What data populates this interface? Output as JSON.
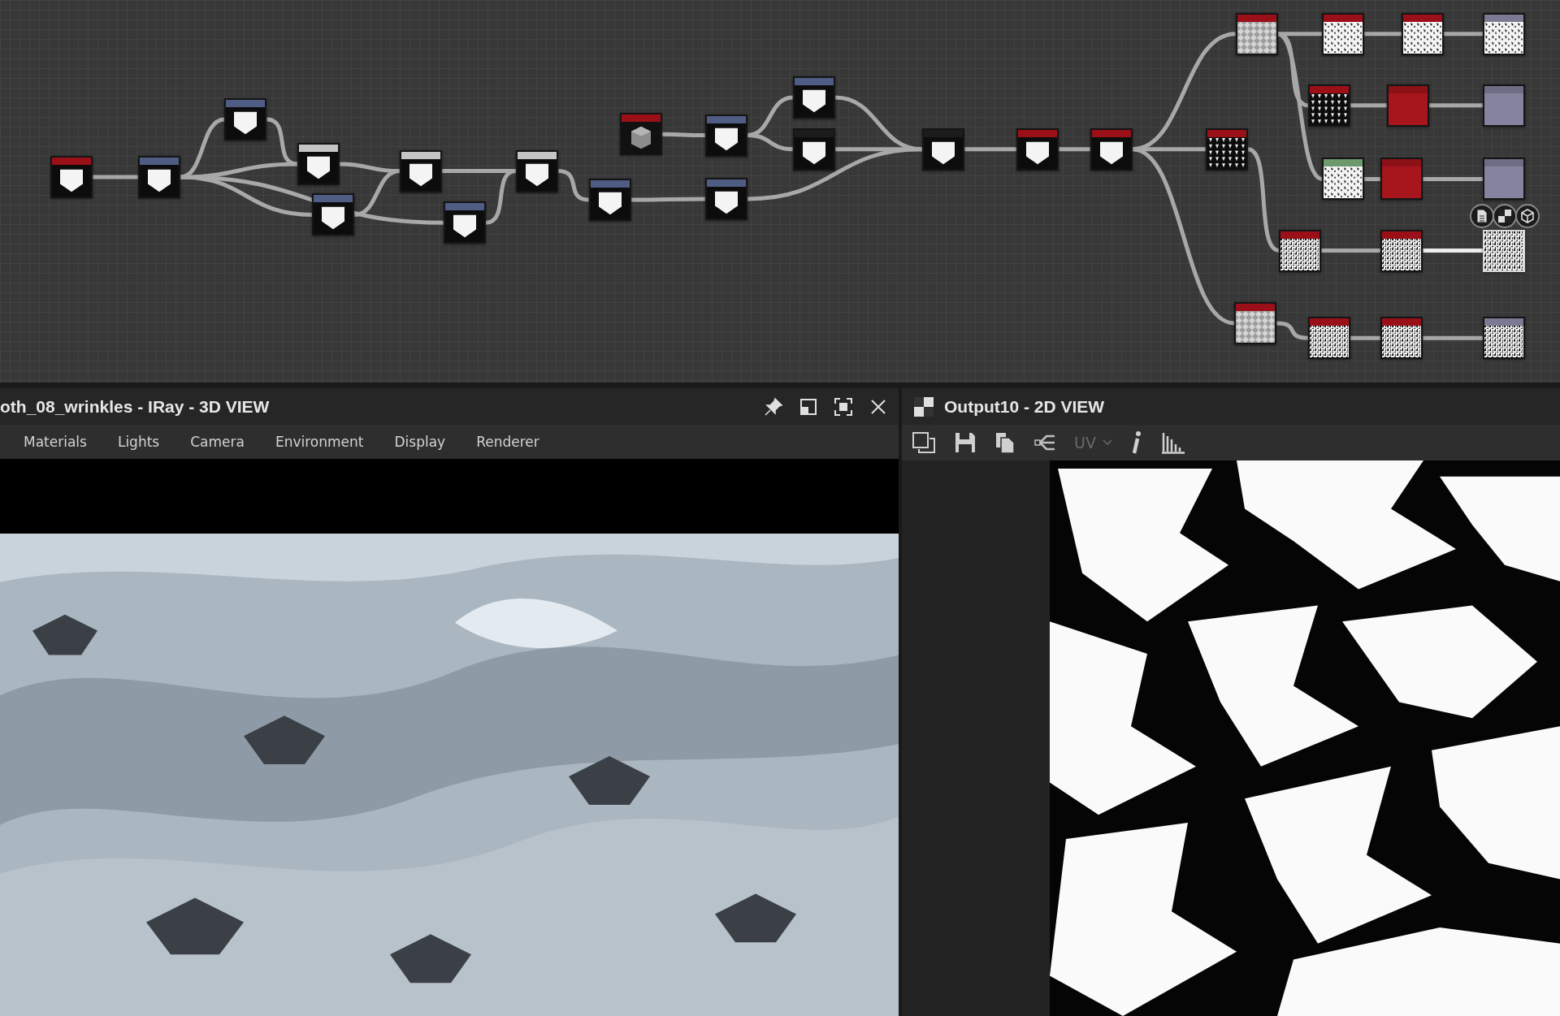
{
  "graph": {
    "nodes": [
      {
        "color": "#9b1018",
        "kind": "shape",
        "selected": false
      },
      {
        "color": "#4f5d85",
        "kind": "shape",
        "selected": false
      },
      {
        "color": "#4f5d85",
        "kind": "shape",
        "selected": false
      },
      {
        "color": "#c4c4c4",
        "kind": "shape",
        "selected": false
      },
      {
        "color": "#4f5d85",
        "kind": "shape",
        "selected": false
      },
      {
        "color": "#c4c4c4",
        "kind": "shape",
        "selected": false
      },
      {
        "color": "#4f5d85",
        "kind": "shape",
        "selected": false
      },
      {
        "color": "#c4c4c4",
        "kind": "shape",
        "selected": false
      },
      {
        "color": "#4f5d85",
        "kind": "shape",
        "selected": false
      },
      {
        "color": "#9b1018",
        "kind": "cube",
        "selected": false
      },
      {
        "color": "#4f5d85",
        "kind": "shape",
        "selected": false
      },
      {
        "color": "#4f5d85",
        "kind": "shape",
        "selected": false
      },
      {
        "color": "#1c1c1c",
        "kind": "shape",
        "selected": false
      },
      {
        "color": "#4f5d85",
        "kind": "shape",
        "selected": false
      },
      {
        "color": "#1c1c1c",
        "kind": "shape",
        "selected": false
      },
      {
        "color": "#9b1018",
        "kind": "shape",
        "selected": false
      },
      {
        "color": "#9b1018",
        "kind": "shape",
        "selected": false
      },
      {
        "color": "#9b1018",
        "kind": "grey-pattern",
        "selected": false
      },
      {
        "color": "#9b1018",
        "kind": "pattern",
        "selected": false
      },
      {
        "color": "#9b1018",
        "kind": "pattern",
        "selected": false
      },
      {
        "color": "#7c7a92",
        "kind": "pattern",
        "selected": false
      },
      {
        "color": "#9b1018",
        "kind": "dark-pattern",
        "selected": false
      },
      {
        "color": "#8c1218",
        "kind": "solid",
        "selected": false
      },
      {
        "color": "#6f6d85",
        "kind": "solid",
        "selected": false
      },
      {
        "color": "#6d9a6d",
        "kind": "pattern",
        "selected": false
      },
      {
        "color": "#8c1218",
        "kind": "solid",
        "selected": false
      },
      {
        "color": "#6f6d85",
        "kind": "solid",
        "selected": false
      },
      {
        "color": "#9b1018",
        "kind": "dark-pattern",
        "selected": false
      },
      {
        "color": "#9b1018",
        "kind": "noise",
        "selected": false
      },
      {
        "color": "#9b1018",
        "kind": "noise",
        "selected": false
      },
      {
        "kind": "noise",
        "selected": true
      },
      {
        "color": "#9b1018",
        "kind": "grey-pattern",
        "selected": false
      },
      {
        "color": "#9b1018",
        "kind": "noise",
        "selected": false
      },
      {
        "color": "#9b1018",
        "kind": "noise",
        "selected": false
      },
      {
        "color": "#7c7a92",
        "kind": "noise",
        "selected": false
      }
    ]
  },
  "view3d": {
    "title": "oth_08_wrinkles - IRay - 3D VIEW",
    "tabs": [
      "Materials",
      "Lights",
      "Camera",
      "Environment",
      "Display",
      "Renderer"
    ]
  },
  "view2d": {
    "title": "Output10 - 2D VIEW",
    "uv": {
      "label": "UV",
      "disabled": true
    }
  }
}
